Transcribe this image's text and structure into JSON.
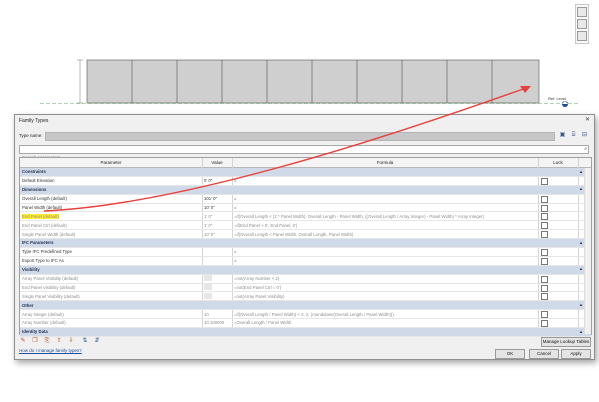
{
  "canvas": {
    "level_label": "Ref. Level",
    "nav_tool_names": [
      "view-cube-icon",
      "pan-icon",
      "zoom-icon"
    ]
  },
  "dialog": {
    "title": "Family Types",
    "close_label": "✕",
    "type_name_label": "Type name:",
    "type_name_value": "",
    "search_placeholder": "Search parameters",
    "columns": {
      "parameter": "Parameter",
      "value": "Value",
      "formula": "Formula",
      "lock": "Lock"
    },
    "rows": [
      {
        "kind": "group",
        "parameter": "Constraints"
      },
      {
        "kind": "param",
        "parameter": "Default Elevation",
        "value": "0' 0\"",
        "formula": "=",
        "lock": true
      },
      {
        "kind": "group",
        "parameter": "Dimensions"
      },
      {
        "kind": "param",
        "parameter": "Overall Length (default)",
        "value": "101' 0\"",
        "formula": "=",
        "lock": true
      },
      {
        "kind": "param",
        "parameter": "Panel Width (default)",
        "value": "10' 0\"",
        "formula": "=",
        "lock": true
      },
      {
        "kind": "param",
        "parameter": "End Panel (default)",
        "value": "1' 0\"",
        "formula": "=if(Overall Length < (2 * Panel Width), Overall Length - Panel Width, ((Overall Length / Array Integer) - Panel Width) * Array Integer)",
        "lock": true,
        "highlight": true,
        "gray": true
      },
      {
        "kind": "param",
        "parameter": "End Panel Ctrl (default)",
        "value": "1' 0\"",
        "formula": "=if(End Panel > 0', End Panel, 0')",
        "lock": true,
        "gray": true
      },
      {
        "kind": "param",
        "parameter": "Single Panel Width (default)",
        "value": "10' 0\"",
        "formula": "=if(Overall Length < Panel Width, Overall Length, Panel Width)",
        "lock": true,
        "gray": true
      },
      {
        "kind": "group",
        "parameter": "IFC Parameters"
      },
      {
        "kind": "param",
        "parameter": "Type IFC Predefined Type",
        "value": "",
        "formula": "=",
        "lock": false
      },
      {
        "kind": "param",
        "parameter": "Export Type to IFC As",
        "value": "",
        "formula": "=",
        "lock": false
      },
      {
        "kind": "group",
        "parameter": "Visibility"
      },
      {
        "kind": "param",
        "parameter": "Array Panel Visibility (default)",
        "value": "",
        "formula": "=not(Array Number < 2)",
        "lock": false,
        "gray": true,
        "valuebox": true
      },
      {
        "kind": "param",
        "parameter": "End Panel Visibility (default)",
        "value": "",
        "formula": "=not(End Panel Ctrl = 0')",
        "lock": false,
        "gray": true,
        "valuebox": true
      },
      {
        "kind": "param",
        "parameter": "Single Panel Visibility (default)",
        "value": "",
        "formula": "=not(Array Panel Visibility)",
        "lock": false,
        "gray": true,
        "valuebox": true
      },
      {
        "kind": "group",
        "parameter": "Other"
      },
      {
        "kind": "param",
        "parameter": "Array Integer (default)",
        "value": "10",
        "formula": "=if(Overall Length / Panel Width) < 2, 2, (rounddown(Overall Length / Panel Width)))",
        "lock": false,
        "gray": true
      },
      {
        "kind": "param",
        "parameter": "Array Number (default)",
        "value": "10.100000",
        "formula": "=Overall Length / Panel Width",
        "lock": false,
        "gray": true
      },
      {
        "kind": "group",
        "parameter": "Identity Data"
      }
    ],
    "manage_lookup_label": "Manage Lookup Tables",
    "help_link": "How do I manage family types?",
    "ok_label": "OK",
    "cancel_label": "Cancel",
    "apply_label": "Apply",
    "toolbar_icons": [
      "edit-parameter-icon",
      "new-parameter-icon",
      "delete-parameter-icon",
      "move-up-icon",
      "move-down-icon",
      "sort-ascending-icon",
      "sort-descending-icon"
    ]
  }
}
